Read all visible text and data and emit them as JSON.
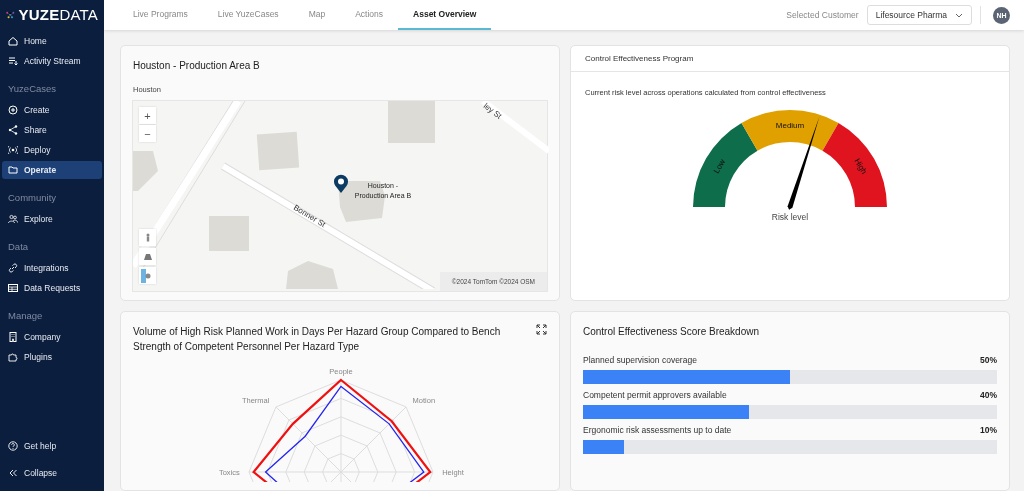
{
  "logo": {
    "text": "**YUZE**DATA"
  },
  "sidebar": {
    "sections": [
      {
        "items": [
          {
            "label": "Home",
            "selected": false
          },
          {
            "label": "Activity Stream",
            "selected": false
          }
        ]
      },
      {
        "header": "YuzeCases",
        "items": [
          {
            "label": "Create",
            "selected": false
          },
          {
            "label": "Share",
            "selected": false
          },
          {
            "label": "Deploy",
            "selected": false
          },
          {
            "label": "Operate",
            "selected": true
          }
        ]
      },
      {
        "header": "Community",
        "items": [
          {
            "label": "Explore",
            "selected": false
          }
        ]
      },
      {
        "header": "Data",
        "items": [
          {
            "label": "Integrations",
            "selected": false
          },
          {
            "label": "Data Requests",
            "selected": false
          }
        ]
      },
      {
        "header": "Manage",
        "items": [
          {
            "label": "Company",
            "selected": false
          },
          {
            "label": "Plugins",
            "selected": false
          }
        ]
      }
    ],
    "bottom_items": [
      {
        "label": "Get help"
      },
      {
        "label": "Collapse"
      }
    ]
  },
  "tabs": [
    {
      "label": "Live Programs",
      "selected": false
    },
    {
      "label": "Live YuzeCases",
      "selected": false
    },
    {
      "label": "Map",
      "selected": false
    },
    {
      "label": "Actions",
      "selected": false
    },
    {
      "label": "Asset Overview",
      "selected": true
    }
  ],
  "customer": {
    "label": "Selected Customer",
    "value": "Lifesource Pharma"
  },
  "avatar": {
    "initials": "NH"
  },
  "location_card": {
    "title": "Houston - Production Area B",
    "subtitle": "Houston",
    "map": {
      "zoom_in": "+",
      "zoom_out": "−",
      "streets": [
        "Bonner St",
        "ley St"
      ],
      "marker_label": "Houston - Production Area B",
      "attribution": "©2024 TomTom ©2024 OSM"
    }
  },
  "program_card": {
    "title": "Control Effectiveness Program",
    "description": "Current risk level across operations calculated from control effectiveness",
    "gauge": {
      "segments": [
        {
          "label": "Low",
          "color": "#0e6e4c"
        },
        {
          "label": "Medium",
          "color": "#e0a000"
        },
        {
          "label": "High",
          "color": "#e0141f"
        }
      ],
      "level": 0.6,
      "caption": "Risk level"
    }
  },
  "radar_card": {
    "title": "Volume of High Risk Planned Work in Days Per Hazard Group Compared to Bench Strength of Competent Personnel Per Hazard Type",
    "axes": [
      "People",
      "Motion",
      "Height",
      "Toxics",
      "Thermal"
    ]
  },
  "score_card": {
    "title": "Control Effectiveness Score Breakdown",
    "scores": [
      {
        "label": "Planned supervision coverage",
        "value": "50%",
        "level": 0.5
      },
      {
        "label": "Competent permit approvers available",
        "value": "40%",
        "level": 0.4
      },
      {
        "label": "Ergonomic risk assessments up to date",
        "value": "10%",
        "level": 0.1
      }
    ]
  }
}
